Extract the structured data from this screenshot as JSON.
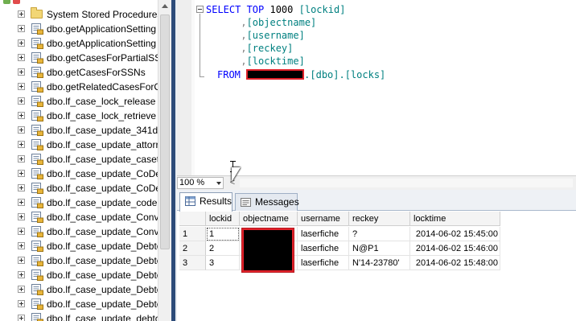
{
  "object_explorer": {
    "folder_label": "System Stored Procedures",
    "items": [
      "dbo.getApplicationSetting",
      "dbo.getApplicationSetting",
      "dbo.getCasesForPartialSSI",
      "dbo.getCasesForSSNs",
      "dbo.getRelatedCasesForC",
      "dbo.lf_case_lock_release",
      "dbo.lf_case_lock_retrieve",
      "dbo.lf_case_update_341da",
      "dbo.lf_case_update_attorr",
      "dbo.lf_case_update_casety",
      "dbo.lf_case_update_CoDe",
      "dbo.lf_case_update_CoDe",
      "dbo.lf_case_update_codeb",
      "dbo.lf_case_update_Conv",
      "dbo.lf_case_update_Conv",
      "dbo.lf_case_update_Debtc",
      "dbo.lf_case_update_Debtc",
      "dbo.lf_case_update_Debtc",
      "dbo.lf_case_update_Debtc",
      "dbo.lf_case_update_Debtc",
      "dbo.lf_case_update_debtc"
    ]
  },
  "editor": {
    "lines": [
      {
        "kw": "SELECT TOP ",
        "num": "1000",
        "rest": " [lockid]"
      },
      {
        "pre": "      ,",
        "rest": "[objectname]"
      },
      {
        "pre": "      ,",
        "rest": "[username]"
      },
      {
        "pre": "      ,",
        "rest": "[reckey]"
      },
      {
        "pre": "      ,",
        "rest": "[locktime]"
      }
    ],
    "from_kw": "FROM",
    "from_rest": ".[dbo].[locks]",
    "zoom": "100 %",
    "scroll_left_glyph": "<"
  },
  "results": {
    "tabs": [
      {
        "label": "Results",
        "active": true
      },
      {
        "label": "Messages",
        "active": false
      }
    ],
    "columns": [
      "",
      "lockid",
      "objectname",
      "username",
      "reckey",
      "locktime"
    ],
    "rows": [
      {
        "num": "1",
        "lockid": "1",
        "objectname": "",
        "username": "laserfiche",
        "reckey": "?",
        "locktime": "2014-06-02 15:45:00"
      },
      {
        "num": "2",
        "lockid": "2",
        "objectname": "",
        "username": "laserfiche",
        "reckey": "N@P1",
        "locktime": "2014-06-02 15:46:00"
      },
      {
        "num": "3",
        "lockid": "3",
        "objectname": "",
        "username": "laserfiche",
        "reckey": "N'14-23780'",
        "locktime": "2014-06-02 15:48:00"
      }
    ]
  },
  "colors": {
    "keyword": "#0000ff",
    "identifier": "#008080",
    "redaction_border": "#e0212a",
    "splitter": "#2d4b79"
  }
}
